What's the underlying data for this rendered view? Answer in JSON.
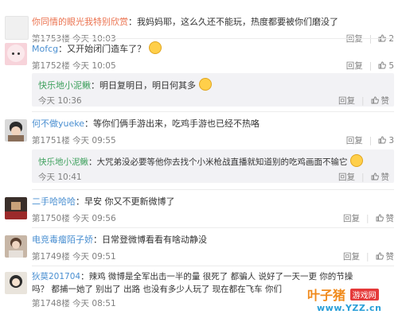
{
  "comments": [
    {
      "user": "你同情的眼光我特别欣赏",
      "text": "：我妈妈耶，这么久还不能玩，热度都要被你们磨没了",
      "floor": "第1753楼 今天 10:03",
      "reply_label": "回复",
      "likes": "2"
    },
    {
      "user": "Mofcg",
      "text": "：又开始闭门造车了？",
      "floor": "第1752楼 今天 10:05",
      "reply_label": "回复",
      "likes": "5"
    },
    {
      "user": "何不做yueke",
      "text": "：等你们俩手游出来，吃鸡手游也已经不热咯",
      "floor": "第1751楼 今天 09:55",
      "reply_label": "回复",
      "likes": "3"
    },
    {
      "user": "二手哈哈哈",
      "text": "：早安 你又不更新微博了",
      "floor": "第1750楼 今天 09:56",
      "reply_label": "回复",
      "likes_label": "赞"
    },
    {
      "user": "电竞毒瘤陌子娇",
      "text": "：日常登微博看看有啥动静没",
      "floor": "第1749楼 今天 09:51",
      "reply_label": "回复",
      "likes_label": "赞"
    },
    {
      "user": "狄莫201704",
      "text": "：辣鸡   微博是全军出击一半的量   很死了   都骗人   说好了一天一更   你的节操",
      "text2": "吗？  都捕一她了  别出了  出路  也没有多少人玩了  现在都在飞车   你们",
      "floor": "第1748楼 今天 08:51"
    }
  ],
  "replies": [
    {
      "user": "快乐地小泥鳅",
      "text": "：明日复明日，明日何其多",
      "time": "今天 10:36",
      "reply_label": "回复",
      "likes_label": "赞"
    },
    {
      "user": "快乐地小泥鳅",
      "text": "：大咒弟没必要等他你去找个小米枪战直播就知道别的吃鸡画面不输它",
      "time": "今天 10:41",
      "reply_label": "回复",
      "likes_label": "赞"
    }
  ],
  "watermark": {
    "brand": "叶子猪",
    "tag": "游戏网",
    "url": "www.YZZ.cn"
  },
  "colors": {
    "username": "#eb7350",
    "brand_blue": "#2a9fd8",
    "brand_orange": "#f08a1c"
  }
}
